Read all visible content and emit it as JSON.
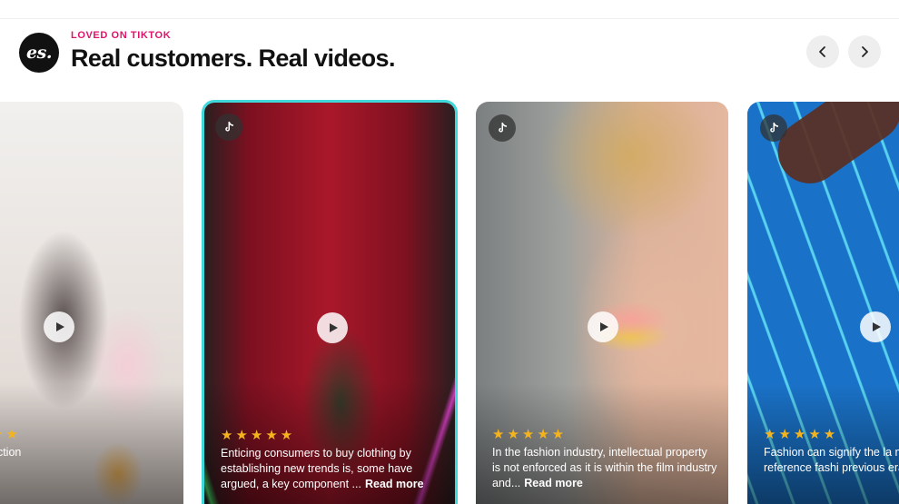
{
  "header": {
    "logo_text": "es.",
    "eyebrow": "LOVED ON TIKTOK",
    "title": "Real customers. Real videos."
  },
  "nav": {
    "prev_icon": "chevron-left-icon",
    "next_icon": "chevron-right-icon"
  },
  "colors": {
    "accent": "#e0136b",
    "active_border": "#3fd9dc",
    "star": "#f5b41e"
  },
  "cards": [
    {
      "stars": "★★",
      "caption": "ection",
      "read_more": ""
    },
    {
      "stars": "★★★★★",
      "caption": "Enticing consumers to buy clothing by establishing new trends is, some have argued, a key component ...",
      "read_more": "Read more"
    },
    {
      "stars": "★★★★★",
      "caption": "In the fashion industry, intellectual property is not enforced as it is within the film industry and...",
      "read_more": "Read more"
    },
    {
      "stars": "★★★★★",
      "caption": "Fashion can signify the la may often reference fashi previous era, leading t...",
      "read_more": ""
    }
  ]
}
